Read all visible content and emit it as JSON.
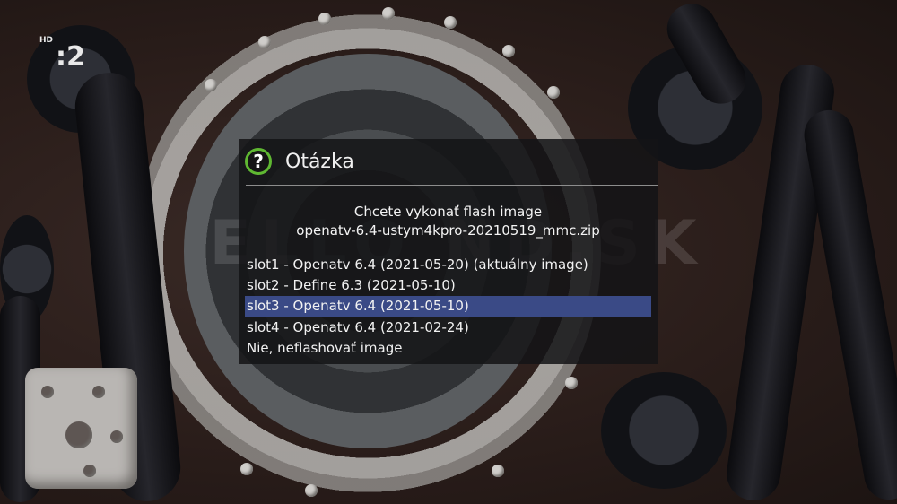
{
  "channel_logo": {
    "hd": "HD",
    "number": ":2"
  },
  "watermark": "ELLO  ND.SK",
  "dialog": {
    "icon": "question-icon",
    "icon_glyph": "?",
    "title": "Otázka",
    "message_line1": "Chcete vykonať flash image",
    "message_line2": "openatv-6.4-ustym4kpro-20210519_mmc.zip",
    "options": [
      {
        "label": "slot1 - Openatv 6.4 (2021-05-20) (aktuálny image)",
        "selected": false
      },
      {
        "label": "slot2 - Define 6.3 (2021-05-10)",
        "selected": false
      },
      {
        "label": "slot3 - Openatv 6.4 (2021-05-10)",
        "selected": true
      },
      {
        "label": "slot4 - Openatv 6.4 (2021-02-24)",
        "selected": false
      },
      {
        "label": "Nie, neflashovať image",
        "selected": false
      }
    ],
    "accent_color": "#5fb832",
    "selection_color": "#3a4a86"
  }
}
